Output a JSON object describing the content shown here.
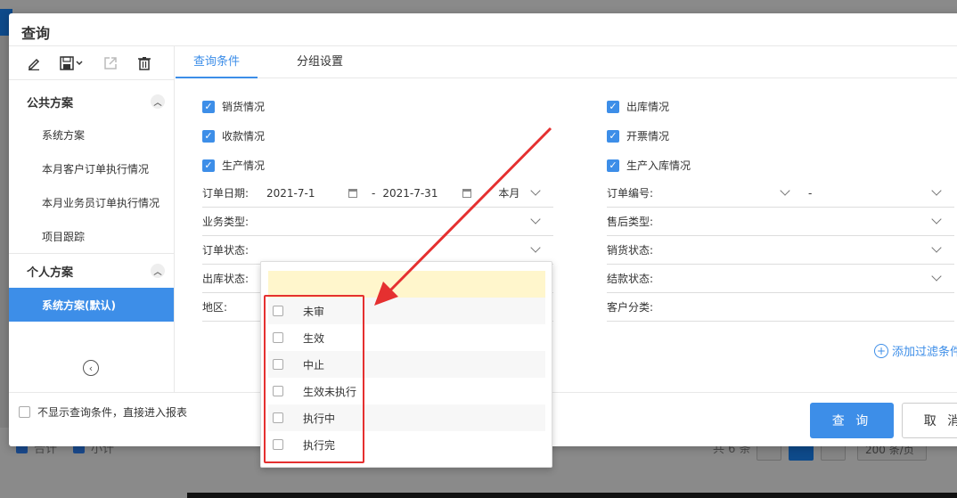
{
  "dialog": {
    "title": "查询"
  },
  "sidebar": {
    "groups": [
      {
        "label": "公共方案",
        "items": [
          "系统方案",
          "本月客户订单执行情况",
          "本月业务员订单执行情况",
          "项目跟踪"
        ]
      },
      {
        "label": "个人方案",
        "items": [
          "系统方案(默认)"
        ]
      }
    ],
    "active_item": "系统方案(默认)",
    "tools": [
      "edit-icon",
      "save-icon",
      "export-icon",
      "delete-icon"
    ]
  },
  "tabs": [
    {
      "label": "查询条件",
      "active": true
    },
    {
      "label": "分组设置",
      "active": false
    }
  ],
  "checkboxes": {
    "left": [
      {
        "label": "销货情况",
        "checked": true
      },
      {
        "label": "收款情况",
        "checked": true
      },
      {
        "label": "生产情况",
        "checked": true
      }
    ],
    "right": [
      {
        "label": "出库情况",
        "checked": true
      },
      {
        "label": "开票情况",
        "checked": true
      },
      {
        "label": "生产入库情况",
        "checked": true
      }
    ]
  },
  "fields": {
    "order_date": {
      "label": "订单日期:",
      "start": "2021-7-1",
      "sep": "-",
      "end": "2021-7-31",
      "period": "本月"
    },
    "business_type": {
      "label": "业务类型:"
    },
    "order_status": {
      "label": "订单状态:"
    },
    "outbound_status": {
      "label": "出库状态:"
    },
    "region": {
      "label": "地区:"
    },
    "order_no": {
      "label": "订单编号:",
      "sep": "-"
    },
    "aftersale_type": {
      "label": "售后类型:"
    },
    "sales_status": {
      "label": "销货状态:"
    },
    "settlement_status": {
      "label": "结款状态:"
    },
    "customer_category": {
      "label": "客户分类:"
    }
  },
  "add_filter": "添加过滤条件",
  "dropdown": {
    "options": [
      "未审",
      "生效",
      "中止",
      "生效未执行",
      "执行中",
      "执行完"
    ]
  },
  "footer": {
    "skip_label": "不显示查询条件，直接进入报表",
    "query_label": "查 询",
    "cancel_label": "取 消"
  },
  "background": {
    "total_label": "合计",
    "subtotal_label": "小计",
    "count_label": "共 6 条",
    "page": "1",
    "page_size": "200 条/页"
  },
  "colors": {
    "accent": "#3d8ee8",
    "highlight": "#e53030",
    "search_bg": "#fff6cc"
  }
}
